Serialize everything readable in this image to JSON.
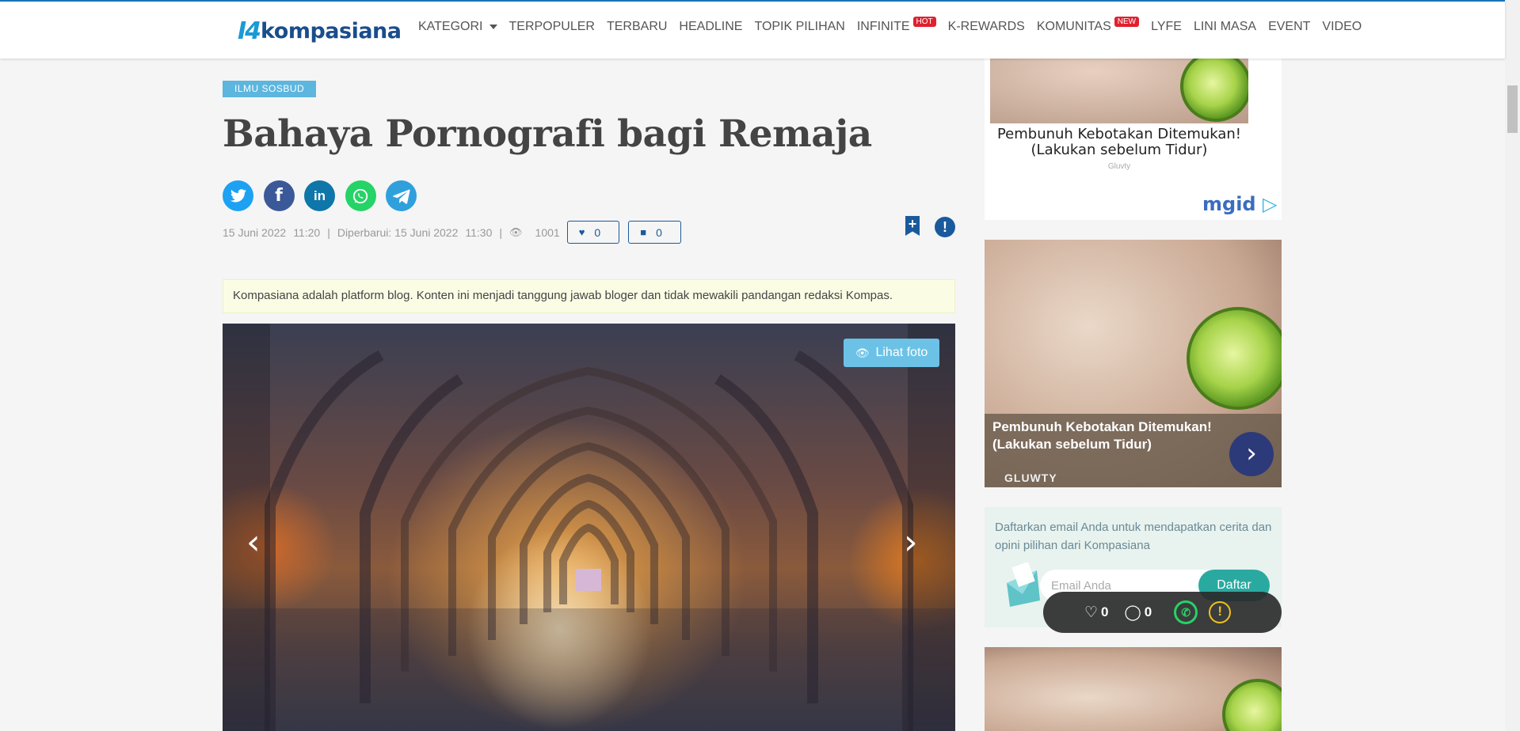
{
  "header": {
    "logo_mark": "I4",
    "logo_word": "kompasiana",
    "nav": [
      {
        "label": "KATEGORI"
      },
      {
        "label": "TERPOPULER"
      },
      {
        "label": "TERBARU"
      },
      {
        "label": "HEADLINE"
      },
      {
        "label": "TOPIK PILIHAN"
      },
      {
        "label": "INFINITE",
        "badge": "HOT"
      },
      {
        "label": "K-REWARDS"
      },
      {
        "label": "KOMUNITAS",
        "badge": "NEW"
      },
      {
        "label": "LYFE"
      },
      {
        "label": "LINI MASA"
      },
      {
        "label": "EVENT"
      },
      {
        "label": "VIDEO"
      }
    ]
  },
  "article": {
    "category": "ILMU SOSBUD",
    "title": "Bahaya Pornografi bagi Remaja",
    "share": [
      "twitter-icon",
      "facebook-icon",
      "linkedin-icon",
      "whatsapp-icon",
      "telegram-icon"
    ],
    "meta": {
      "date": "15 Juni 2022",
      "time": "11:20",
      "updated": "Diperbarui: 15 Juni 2022",
      "updated_time": "11:30",
      "views": "1001",
      "likes": "0",
      "comments": "0"
    },
    "notice": "Kompasiana adalah platform blog. Konten ini menjadi tanggung jawab bloger dan tidak mewakili pandangan redaksi Kompas.",
    "view_photo": "Lihat foto"
  },
  "sidebar": {
    "ad1": {
      "caption": "Pembunuh Kebotakan Ditemukan! (Lakukan sebelum Tidur)",
      "source": "Gluvty",
      "network": "mgid"
    },
    "ad2": {
      "headline": "Pembunuh Kebotakan Ditemukan! (Lakukan sebelum Tidur)",
      "brand": "GLUWTY"
    },
    "subscribe": {
      "text": "Daftarkan email Anda untuk mendapatkan cerita dan opini pilihan dari Kompasiana",
      "placeholder": "Email Anda",
      "button": "Daftar"
    }
  },
  "floatbar": {
    "likes": "0",
    "comments": "0"
  },
  "colors": {
    "brand": "#1a4d8c",
    "accent": "#5cb6de",
    "meta_blue": "#1a5a9c",
    "hot": "#e0212e"
  }
}
